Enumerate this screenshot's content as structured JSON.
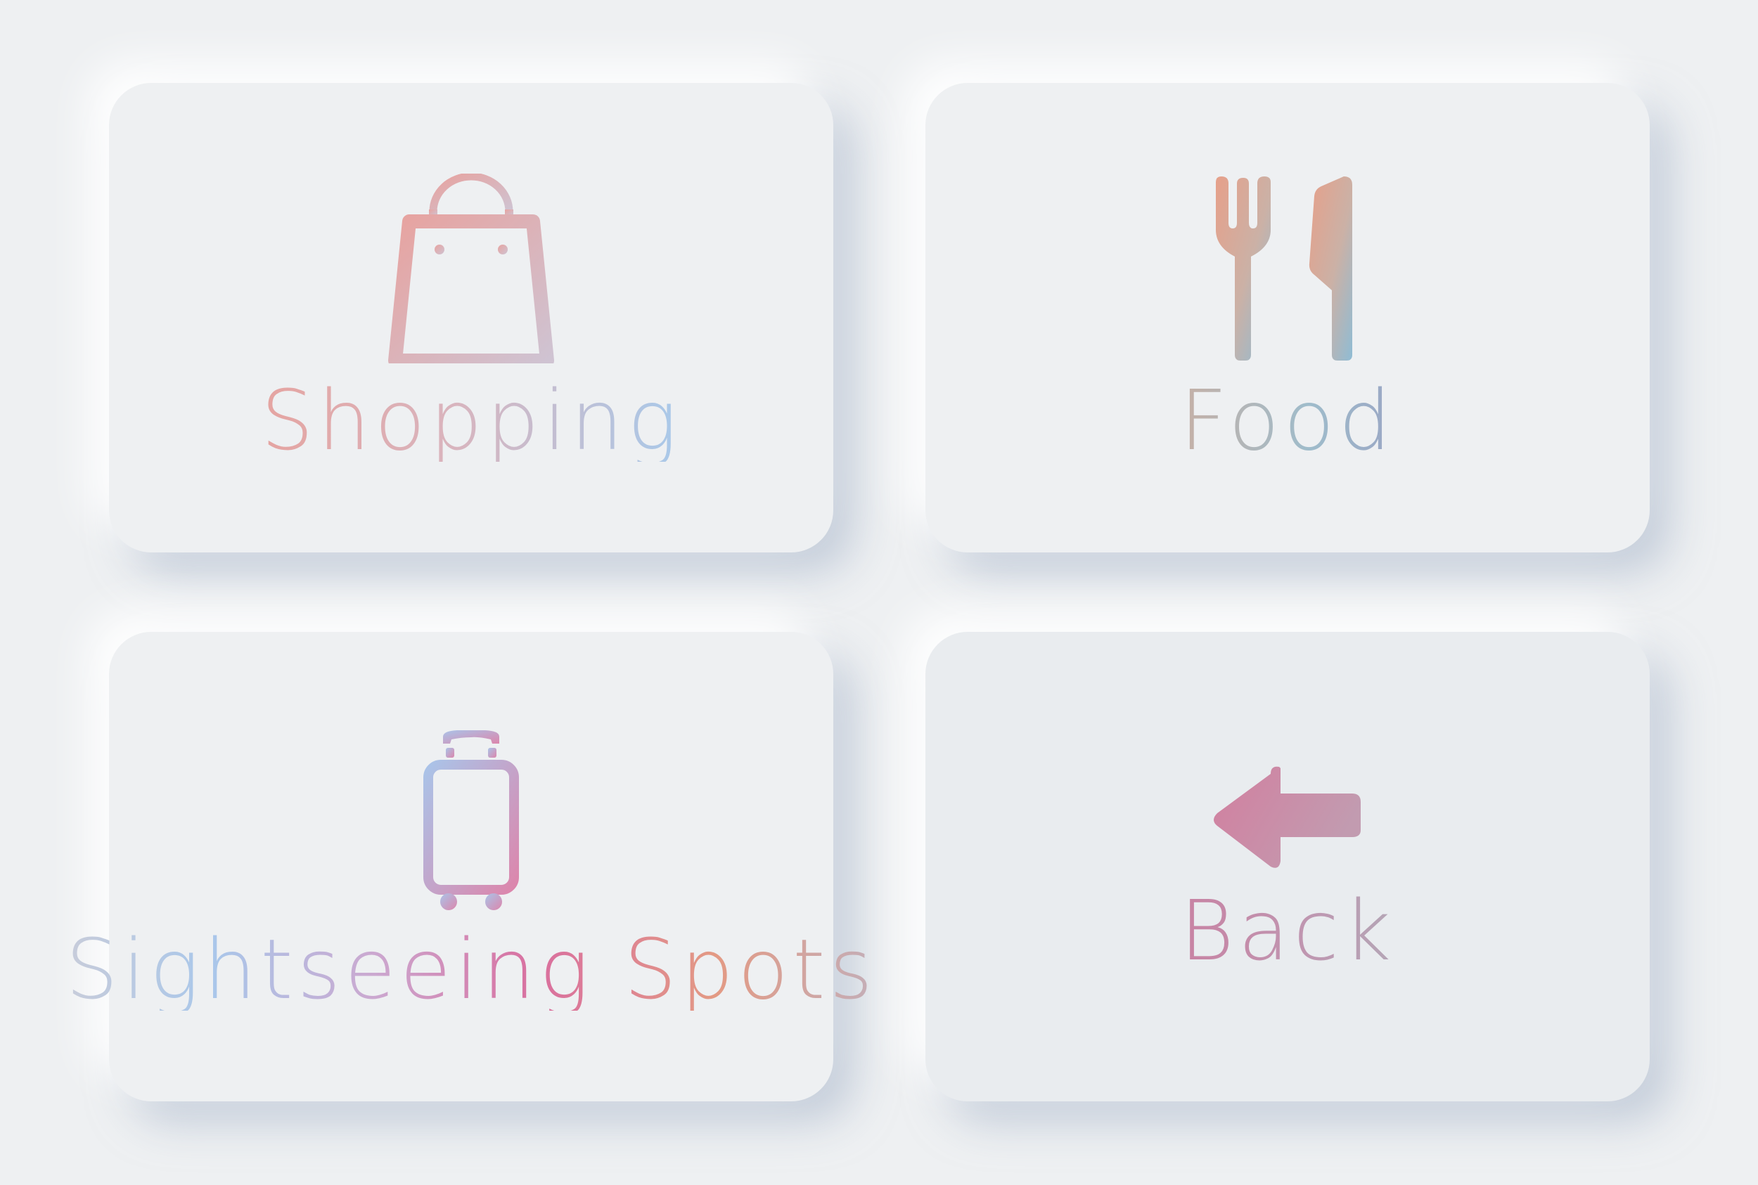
{
  "menu": {
    "items": [
      {
        "label": "Shopping",
        "icon": "shopping-bag-icon"
      },
      {
        "label": "Food",
        "icon": "fork-knife-icon"
      },
      {
        "label": "Sightseeing Spots",
        "icon": "suitcase-icon"
      },
      {
        "label": "Back",
        "icon": "arrow-left-icon"
      }
    ]
  },
  "colors": {
    "background": "#eef0f2",
    "accent_pink": "#d77fa2",
    "accent_peach": "#e3a08b",
    "accent_blue": "#a9c7ea"
  }
}
